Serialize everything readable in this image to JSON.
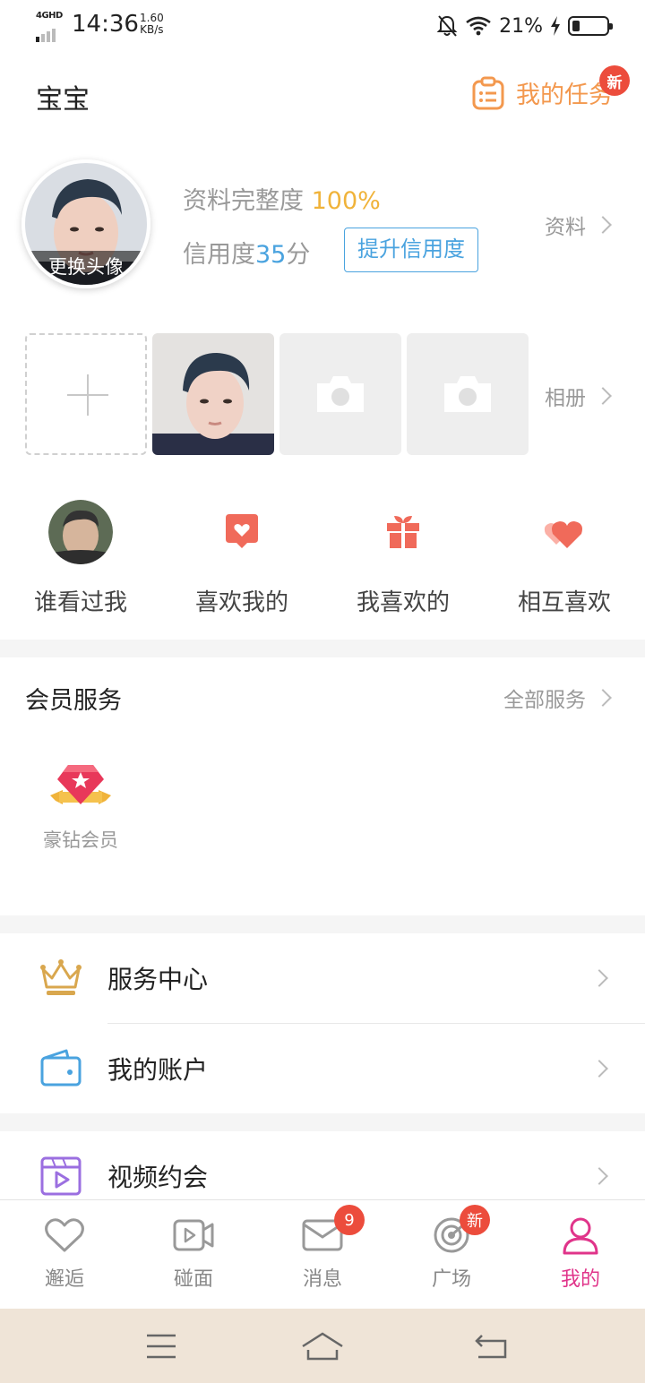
{
  "status_bar": {
    "network": "4GHD",
    "time": "14:36",
    "speed_value": "1.60",
    "speed_unit": "KB/s",
    "battery_percent": "21%",
    "battery_level": 0.21
  },
  "header": {
    "title": "宝宝",
    "tasks_label": "我的任务",
    "tasks_badge": "新"
  },
  "profile": {
    "change_avatar_label": "更换头像",
    "completeness_label": "资料完整度",
    "completeness_value": "100%",
    "credit_label": "信用度",
    "credit_score": "35",
    "credit_unit": "分",
    "improve_credit_button": "提升信用度",
    "profile_link": "资料"
  },
  "album": {
    "link": "相册"
  },
  "quick_actions": [
    {
      "label": "谁看过我"
    },
    {
      "label": "喜欢我的"
    },
    {
      "label": "我喜欢的"
    },
    {
      "label": "相互喜欢"
    }
  ],
  "member_services": {
    "title": "会员服务",
    "all_link": "全部服务",
    "items": [
      {
        "label": "豪钻会员"
      }
    ]
  },
  "menu": {
    "service_center": "服务中心",
    "my_account": "我的账户",
    "video_dating": "视频约会"
  },
  "bottom_nav": [
    {
      "label": "邂逅",
      "icon": "heart-icon"
    },
    {
      "label": "碰面",
      "icon": "video-icon"
    },
    {
      "label": "消息",
      "icon": "mail-icon",
      "badge": "9"
    },
    {
      "label": "广场",
      "icon": "radar-icon",
      "badge": "新"
    },
    {
      "label": "我的",
      "icon": "user-icon",
      "active": true
    }
  ],
  "colors": {
    "orange": "#f3984e",
    "yellow": "#f0b33a",
    "blue": "#4aa3df",
    "pink_active": "#e0348a",
    "badge_red": "#ec4c3c",
    "coral": "#f06a5a"
  }
}
